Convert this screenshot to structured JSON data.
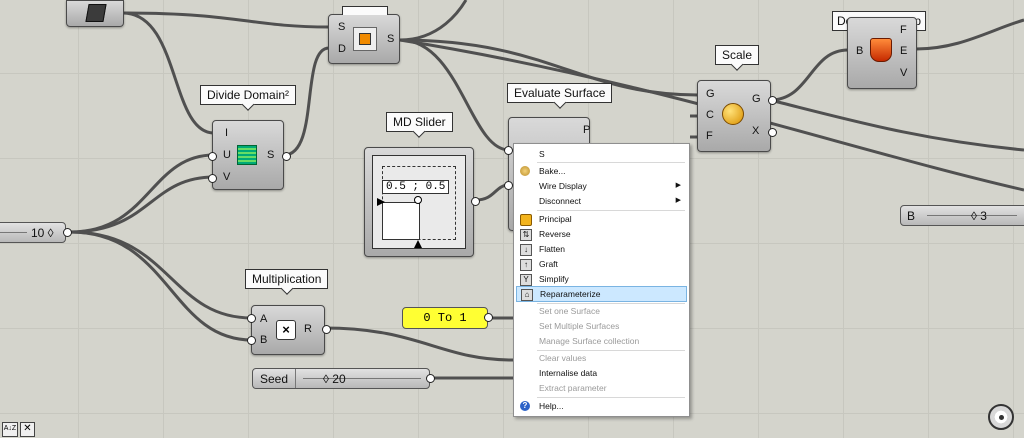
{
  "components": {
    "divide_domain": {
      "title": "Divide Domain²",
      "inputs": [
        "I",
        "U",
        "V"
      ],
      "outputs": [
        "S"
      ]
    },
    "sub_surface": {
      "inputs": [
        "S",
        "D"
      ],
      "outputs": [
        "S"
      ]
    },
    "md_slider": {
      "title": "MD Slider",
      "value": "0.5 ; 0.5"
    },
    "evaluate_surface": {
      "title": "Evaluate Surface",
      "outputs": [
        "P"
      ]
    },
    "scale": {
      "title": "Scale",
      "inputs": [
        "G",
        "C",
        "F"
      ],
      "outputs": [
        "G",
        "X"
      ]
    },
    "deconstruct": {
      "title_visible": "De",
      "title_visible_end": "p",
      "inputs": [
        "B"
      ],
      "outputs": [
        "F",
        "E",
        "V"
      ]
    },
    "multiplication": {
      "title": "Multiplication",
      "inputs": [
        "A",
        "B"
      ],
      "outputs": [
        "R"
      ]
    },
    "number_slider_left": {
      "value": "10 ◊"
    },
    "number_slider_right": {
      "label": "B",
      "value": "◊ 3"
    },
    "panel": {
      "text": "0 To 1"
    },
    "seed_slider": {
      "label": "Seed",
      "value": "◊ 20"
    }
  },
  "context_menu": {
    "header": "S",
    "items": [
      {
        "label": "Bake...",
        "icon": "bake-icon",
        "enabled": true
      },
      {
        "label": "Wire Display",
        "submenu": true,
        "enabled": true
      },
      {
        "label": "Disconnect",
        "submenu": true,
        "enabled": true
      },
      {
        "label": "Principal",
        "icon": "principal-icon",
        "enabled": true
      },
      {
        "label": "Reverse",
        "icon": "reverse-icon",
        "enabled": true
      },
      {
        "label": "Flatten",
        "icon": "flatten-icon",
        "enabled": true
      },
      {
        "label": "Graft",
        "icon": "graft-icon",
        "enabled": true
      },
      {
        "label": "Simplify",
        "icon": "simplify-icon",
        "enabled": true
      },
      {
        "label": "Reparameterize",
        "icon": "reparameterize-icon",
        "enabled": true,
        "selected": true
      },
      {
        "label": "Set one Surface",
        "enabled": false
      },
      {
        "label": "Set Multiple Surfaces",
        "enabled": false
      },
      {
        "label": "Manage Surface collection",
        "enabled": false
      },
      {
        "label": "Clear values",
        "enabled": false
      },
      {
        "label": "Internalise data",
        "enabled": true
      },
      {
        "label": "Extract parameter",
        "enabled": false
      },
      {
        "label": "Help...",
        "icon": "help-icon",
        "enabled": true
      }
    ]
  },
  "corner_buttons": {
    "sort": "A↓Z",
    "close": "✕"
  },
  "colors": {
    "canvas": "#d4d4cc",
    "wire": "#5a5a5a",
    "panel_yellow": "#ffff33",
    "menu_highlight": "#cce8ff"
  }
}
